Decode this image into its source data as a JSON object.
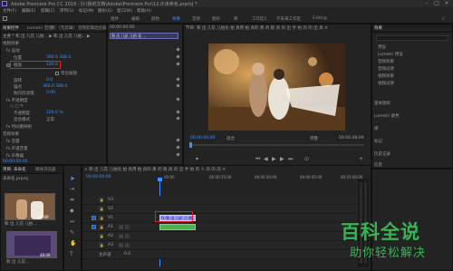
{
  "titlebar": {
    "title": "Adobe Premiere Pro CC 2018 - D:\\我的文档\\Adobe\\Premiere Pro\\12.0\\未命名.prproj *"
  },
  "menu": [
    "文件(F)",
    "编辑(E)",
    "剪辑(C)",
    "序列(S)",
    "标记(M)",
    "图形(G)",
    "窗口(W)",
    "帮助(H)"
  ],
  "workspaces": [
    "组件",
    "编辑",
    "颜色",
    "效果",
    "音频",
    "图形",
    "库",
    "工作区1",
    "学未来工作区",
    "Editing"
  ],
  "effect_controls": {
    "tabs": [
      "效果控件",
      "Lumetri 范围",
      "源：(无剪辑)",
      "音频剪辑混合器："
    ],
    "clip_line": "主要 * 和 出 儿花 儿拍... ▶ 和 出 儿花 儿拍... ▶",
    "section_video": "视频效果",
    "motion": "fx 运动",
    "position_label": "位置",
    "position_value": "360.0    288.0",
    "scale_label": "缩放",
    "scale_value": "100.0",
    "uniform_scale_label": "等比缩放",
    "rotation_label": "旋转",
    "rotation_value": "0.0",
    "anchor_label": "锚点",
    "anchor_value": "360.0  288.0",
    "antiflicker_label": "防闪烁滤镜",
    "antiflicker_value": "0.00",
    "opacity_section": "fx 不透明度",
    "opacity_label": "不透明度",
    "opacity_value": "100.0 %",
    "blend_label": "混合模式",
    "blend_value": "正常",
    "time_remap": "fx 时间重映射",
    "audio_effects": "音频效果",
    "audio_items": [
      "fx 音量",
      "fx 声道音量",
      "fx 声像器"
    ],
    "timecode": "00:00:00:00",
    "mini_clip_label": "和 出 儿花 儿拍 化 ..."
  },
  "program_monitor": {
    "header": "节目: 和 出 儿花 儿拍化 拍 具用 拍 具的 勇 的 跑 具 的 出 手 拍 的 的 出 具 ≡",
    "timecode_left": "00:00:00:00",
    "fit_label": "适合",
    "quality_label": "完整",
    "timecode_right": "00:00:48:09"
  },
  "effects_panel": {
    "tab": "效果",
    "items": [
      "预设",
      "Lumetri 预设",
      "音频效果",
      "音频过渡",
      "视频效果",
      "视频过渡"
    ],
    "lower_items": [
      "基本图形",
      "Lumetri 颜色",
      "库",
      "标记",
      "历史记录",
      "信息"
    ]
  },
  "project_panel": {
    "tabs": [
      "项目: 未命名",
      "媒体浏览器"
    ],
    "file": "未命名.prproj",
    "thumb1_label": "和 出 儿花 儿拍...",
    "thumb2_label": "和 出 儿花...",
    "thumb1_duration": "48:09",
    "thumb2_duration": "48:09"
  },
  "timeline": {
    "header": "× 和 出 儿花 儿拍化 拍 具用 拍 具的 勇 的 跑 具 的 出 手 拍 的 人 的 的 前 ≡",
    "timecode": "00:00:00:00",
    "ruler_marks": [
      "00:00",
      "00:00:15:00",
      "00:00:30:00",
      "00:00:45:00",
      "00:01:00:00"
    ],
    "tracks": [
      "V3",
      "V2",
      "V1",
      "A1",
      "A2",
      "A3",
      "主声道"
    ],
    "master_value": "0.0",
    "clip_label": "fx 和 出 儿花 儿 拍",
    "clip_label_v": "和 出 儿花 儿 拍 [V]"
  },
  "watermark": {
    "title": "百科全说",
    "subtitle": "助你轻松解决"
  },
  "colors": {
    "accent": "#3e8fff",
    "highlight_box": "#e02020",
    "clip_video": "#9aa0ff",
    "clip_audio": "#4fb04f",
    "watermark": "#36b553"
  }
}
